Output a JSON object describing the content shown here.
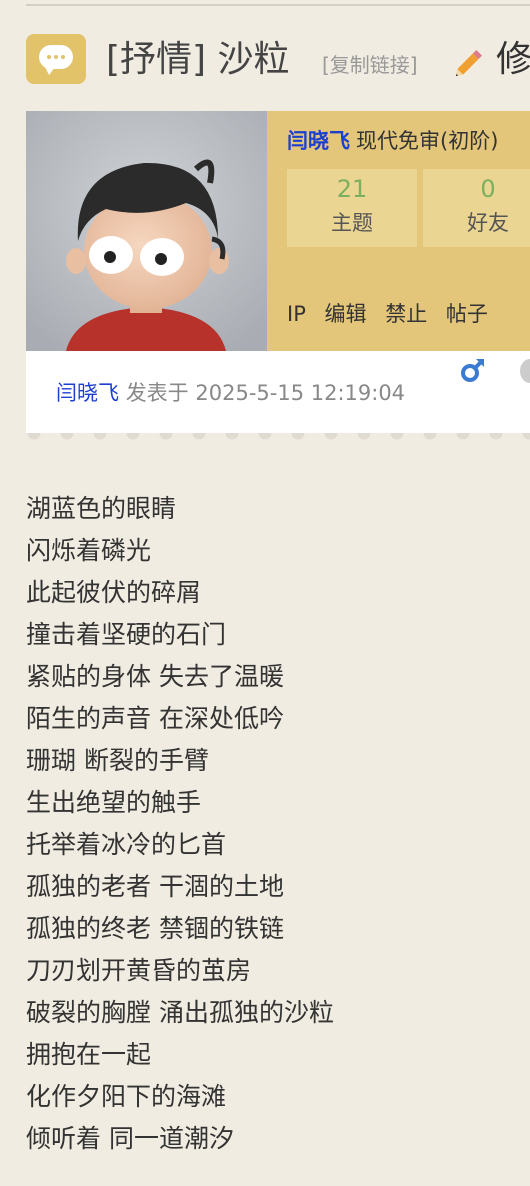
{
  "thread": {
    "title": "[抒情] 沙粒",
    "copy_link": "[复制链接]",
    "edit_label": "修"
  },
  "author": {
    "name": "闫晓飞",
    "rank": "现代免审(初阶)",
    "stats": [
      {
        "value": "21",
        "label": "主题"
      },
      {
        "value": "0",
        "label": "好友"
      }
    ],
    "actions": [
      "IP",
      "编辑",
      "禁止",
      "帖子"
    ]
  },
  "post_meta": {
    "author": "闫晓飞",
    "posted_label": "发表于",
    "datetime": "2025-5-15 12:19:04"
  },
  "icons": {
    "title_icon": "chat-bubble-icon",
    "edit_icon": "pencil-icon",
    "gender_icon": "male-icon"
  },
  "colors": {
    "accent": "#e3c67a",
    "link": "#1a3fd1",
    "stat_number": "#7ab05e",
    "background": "#f1ece1"
  },
  "poem": [
    "湖蓝色的眼睛",
    "闪烁着磷光",
    "此起彼伏的碎屑",
    "撞击着坚硬的石门",
    "紧贴的身体 失去了温暖",
    "陌生的声音 在深处低吟",
    "珊瑚 断裂的手臂",
    "生出绝望的触手",
    "托举着冰冷的匕首",
    "孤独的老者 干涸的土地",
    "孤独的终老 禁锢的铁链",
    "刀刃划开黄昏的茧房",
    "破裂的胸膛 涌出孤独的沙粒",
    "拥抱在一起",
    "化作夕阳下的海滩",
    "倾听着 同一道潮汐"
  ]
}
